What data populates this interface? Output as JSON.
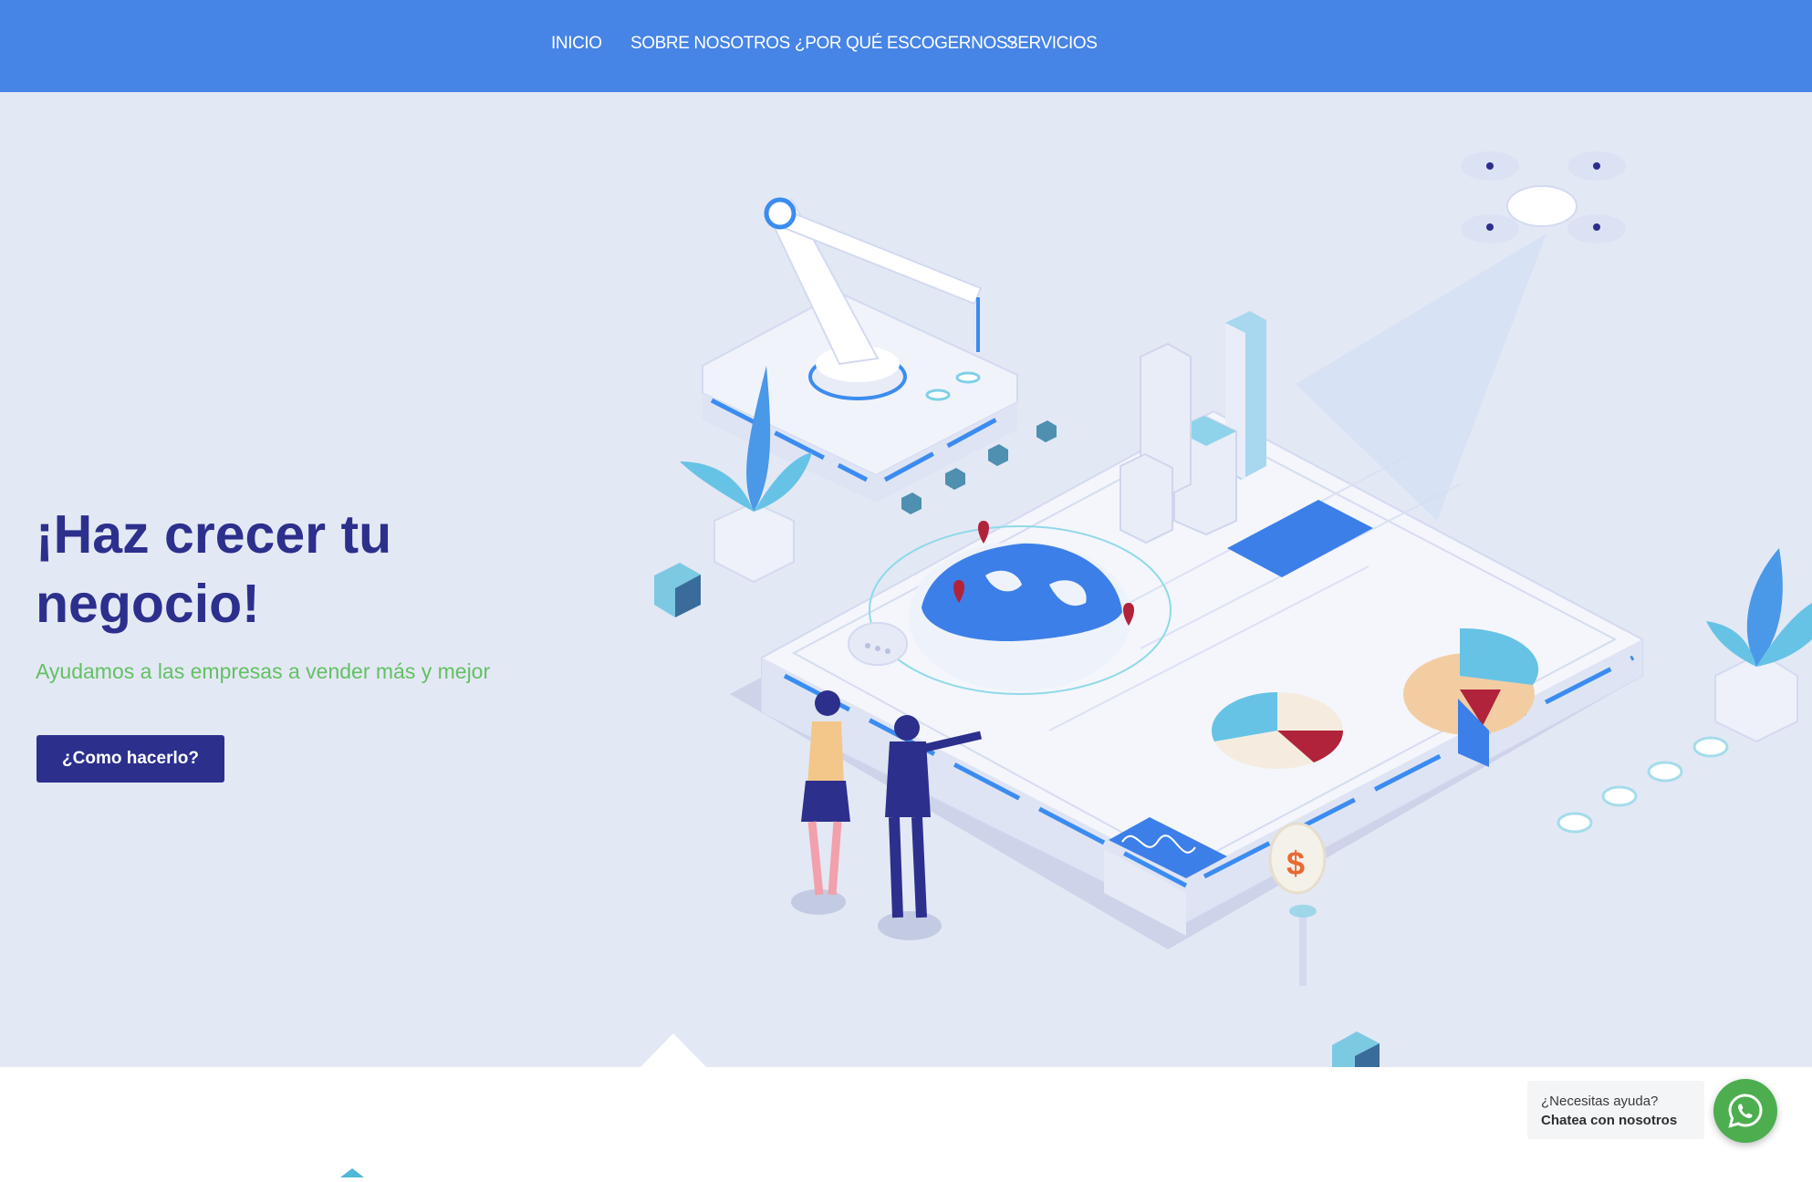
{
  "nav": {
    "items": [
      {
        "label": "INICIO"
      },
      {
        "label": "SOBRE NOSOTROS"
      },
      {
        "label": "¿POR QUÉ ESCOGERNOS?"
      },
      {
        "label": "SERVICIOS"
      }
    ]
  },
  "hero": {
    "title": "¡Haz crecer tu negocio!",
    "subtitle": "Ayudamos a las empresas a vender más y mejor",
    "cta_label": "¿Como hacerlo?",
    "illustration_icon": "isometric-business-growth-illustration"
  },
  "chat_widget": {
    "line1": "¿Necesitas ayuda?",
    "line2": "Chatea con nosotros",
    "icon": "whatsapp-icon"
  },
  "colors": {
    "nav_background": "#4684e6",
    "hero_background": "#e3e8f5",
    "title": "#2c2f8c",
    "subtitle": "#63c063",
    "cta_background": "#2c2f8c",
    "whatsapp": "#4cae4f"
  }
}
